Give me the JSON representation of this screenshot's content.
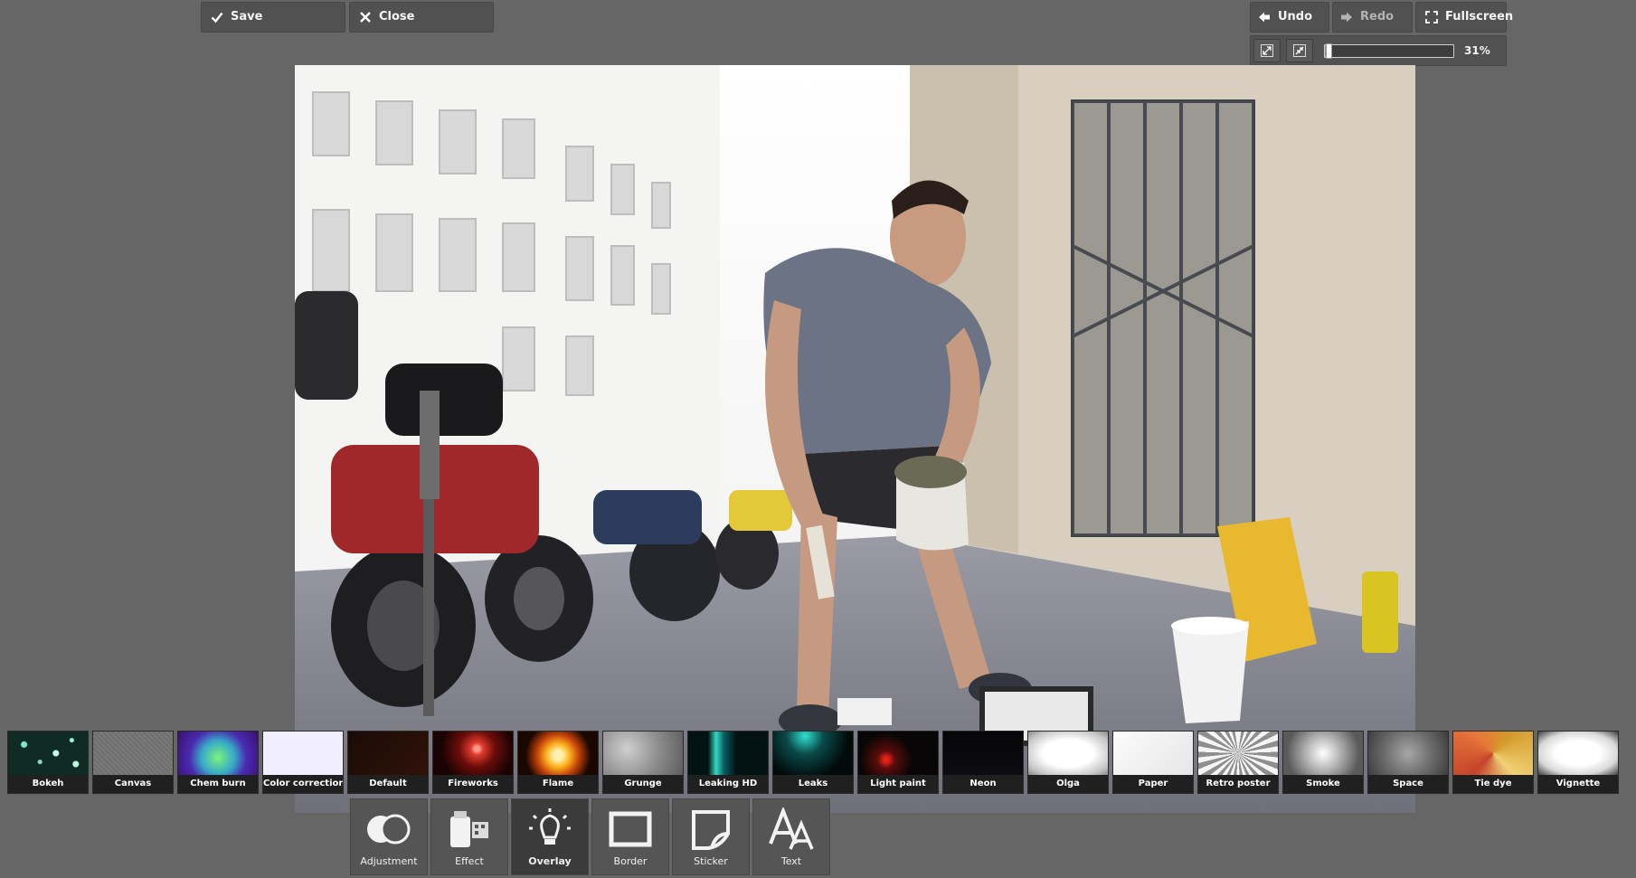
{
  "toolbar": {
    "save_label": "Save",
    "close_label": "Close",
    "undo_label": "Undo",
    "redo_label": "Redo",
    "fullscreen_label": "Fullscreen"
  },
  "zoom": {
    "value_label": "31%",
    "level": 0.31
  },
  "overlays": [
    {
      "label": "Bokeh",
      "icon": "bokeh"
    },
    {
      "label": "Canvas",
      "icon": "canvas"
    },
    {
      "label": "Chem burn",
      "icon": "chem-burn"
    },
    {
      "label": "Color correction",
      "icon": "color-correction"
    },
    {
      "label": "Default",
      "icon": "default"
    },
    {
      "label": "Fireworks",
      "icon": "fireworks"
    },
    {
      "label": "Flame",
      "icon": "flame"
    },
    {
      "label": "Grunge",
      "icon": "grunge"
    },
    {
      "label": "Leaking HD",
      "icon": "leaking-hd"
    },
    {
      "label": "Leaks",
      "icon": "leaks"
    },
    {
      "label": "Light paint",
      "icon": "light-paint"
    },
    {
      "label": "Neon",
      "icon": "neon"
    },
    {
      "label": "Olga",
      "icon": "olga"
    },
    {
      "label": "Paper",
      "icon": "paper"
    },
    {
      "label": "Retro poster",
      "icon": "retro-poster"
    },
    {
      "label": "Smoke",
      "icon": "smoke"
    },
    {
      "label": "Space",
      "icon": "space"
    },
    {
      "label": "Tie dye",
      "icon": "tie-dye"
    },
    {
      "label": "Vignette",
      "icon": "vignette"
    }
  ],
  "tools": [
    {
      "label": "Adjustment",
      "icon": "adjustment-icon",
      "active": false
    },
    {
      "label": "Effect",
      "icon": "effect-icon",
      "active": false
    },
    {
      "label": "Overlay",
      "icon": "overlay-icon",
      "active": true
    },
    {
      "label": "Border",
      "icon": "border-icon",
      "active": false
    },
    {
      "label": "Sticker",
      "icon": "sticker-icon",
      "active": false
    },
    {
      "label": "Text",
      "icon": "text-icon",
      "active": false
    }
  ],
  "colors": {
    "background": "#666666",
    "button": "#515151",
    "active_tool": "#3b3b3b"
  }
}
